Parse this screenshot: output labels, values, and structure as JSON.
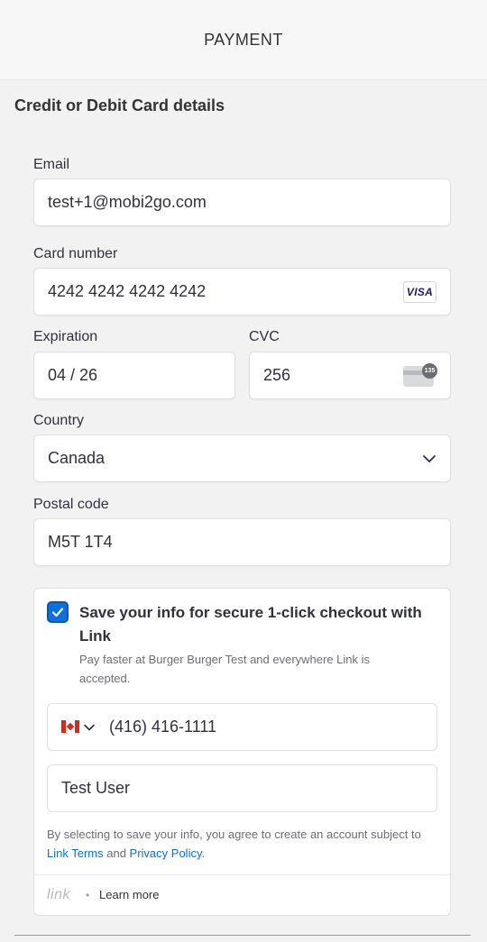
{
  "header": {
    "title": "PAYMENT"
  },
  "section": {
    "title": "Credit or Debit Card details"
  },
  "form": {
    "email_label": "Email",
    "email_value": "test+1@mobi2go.com",
    "card_label": "Card number",
    "card_value": "4242 4242 4242 4242",
    "card_brand": "VISA",
    "expiration_label": "Expiration",
    "expiration_value": "04 / 26",
    "cvc_label": "CVC",
    "cvc_value": "256",
    "cvc_icon_text": "135",
    "country_label": "Country",
    "country_value": "Canada",
    "postal_label": "Postal code",
    "postal_value": "M5T 1T4"
  },
  "link": {
    "checkbox_checked": true,
    "title": "Save your info for secure 1-click checkout with Link",
    "subtitle": "Pay faster at Burger Burger Test and everywhere Link is accepted.",
    "phone_value": "(416) 416-1111",
    "name_value": "Test User",
    "terms_prefix": "By selecting to save your info, you agree to create an account subject to ",
    "terms_link": "Link Terms",
    "terms_and": " and ",
    "privacy_link": "Privacy Policy",
    "terms_suffix": ".",
    "logo_text": "link",
    "dot": "•",
    "learn_more": "Learn more"
  },
  "colors": {
    "accent": "#0f6fde",
    "background": "#f2f2f2"
  }
}
